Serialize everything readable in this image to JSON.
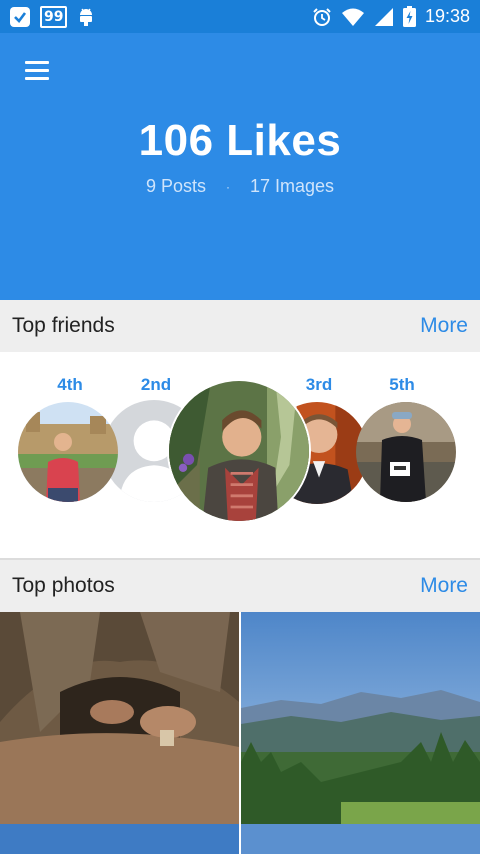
{
  "status_bar": {
    "time": "19:38",
    "notification_99": "99",
    "icons": [
      "check-badge-icon",
      "android-icon",
      "alarm-icon",
      "wifi-icon",
      "signal-icon",
      "battery-icon"
    ]
  },
  "header": {
    "likes_title": "106 Likes",
    "posts": "9 Posts",
    "separator": "·",
    "images": "17 Images",
    "bg_color": "#2d8be6"
  },
  "top_friends": {
    "title": "Top friends",
    "more": "More",
    "ranks": {
      "first": "",
      "second": "2nd",
      "third": "3rd",
      "fourth": "4th",
      "fifth": "5th"
    }
  },
  "top_photos": {
    "title": "Top photos",
    "more": "More"
  }
}
